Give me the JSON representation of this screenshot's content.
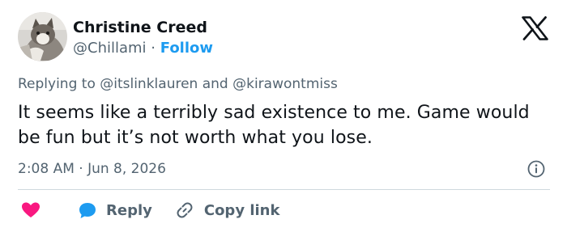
{
  "author": {
    "name": "Christine Creed",
    "handle": "@Chillami",
    "separator": "·",
    "follow_label": "Follow"
  },
  "reply_context": "Replying to @itslinklauren and @kirawontmiss",
  "tweet": {
    "text": "It seems like a terribly sad existence to me.  Game would be fun but it’s not worth what you lose."
  },
  "timestamp": "2:08 AM · Jun 8, 2026",
  "actions": {
    "reply_label": "Reply",
    "copy_link_label": "Copy link"
  },
  "icons": {
    "logo": "x-logo-icon",
    "like": "heart-icon",
    "reply": "speech-bubble-icon",
    "copy": "link-icon",
    "info": "info-icon"
  },
  "colors": {
    "text": "#0f1419",
    "secondary": "#536471",
    "accent": "#1d9bf0",
    "like": "#f91880",
    "divider": "#cfd9de"
  }
}
